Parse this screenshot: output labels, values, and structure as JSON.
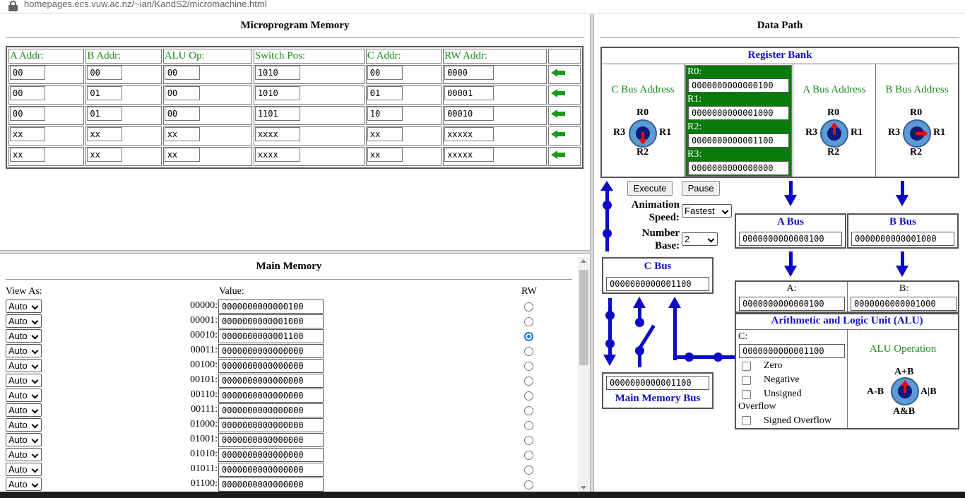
{
  "browser": {
    "url": "homepages.ecs.vuw.ac.nz/~ian/KandS2/micromachine.html"
  },
  "micro": {
    "title": "Microprogram Memory",
    "headers": [
      "A Addr:",
      "B Addr:",
      "ALU Op:",
      "Switch Pos:",
      "C Addr:",
      "RW Addr:"
    ],
    "rows": [
      [
        "00",
        "00",
        "00",
        "1010",
        "00",
        "0000"
      ],
      [
        "00",
        "01",
        "00",
        "1010",
        "01",
        "00001"
      ],
      [
        "00",
        "01",
        "00",
        "1101",
        "10",
        "00010"
      ],
      [
        "xx",
        "xx",
        "xx",
        "xxxx",
        "xx",
        "xxxxx"
      ],
      [
        "xx",
        "xx",
        "xx",
        "xxxx",
        "xx",
        "xxxxx"
      ]
    ]
  },
  "mainmem": {
    "title": "Main Memory",
    "view_as": "View As:",
    "value": "Value:",
    "rw": "RW",
    "rows": [
      {
        "view": "Auto",
        "addr": "00000:",
        "val": "0000000000000100",
        "rw": false
      },
      {
        "view": "Auto",
        "addr": "00001:",
        "val": "0000000000001000",
        "rw": false
      },
      {
        "view": "Auto",
        "addr": "00010:",
        "val": "0000000000001100",
        "rw": true
      },
      {
        "view": "Auto",
        "addr": "00011:",
        "val": "0000000000000000",
        "rw": false
      },
      {
        "view": "Auto",
        "addr": "00100:",
        "val": "0000000000000000",
        "rw": false
      },
      {
        "view": "Auto",
        "addr": "00101:",
        "val": "0000000000000000",
        "rw": false
      },
      {
        "view": "Auto",
        "addr": "00110:",
        "val": "0000000000000000",
        "rw": false
      },
      {
        "view": "Auto",
        "addr": "00111:",
        "val": "0000000000000000",
        "rw": false
      },
      {
        "view": "Auto",
        "addr": "01000:",
        "val": "0000000000000000",
        "rw": false
      },
      {
        "view": "Auto",
        "addr": "01001:",
        "val": "0000000000000000",
        "rw": false
      },
      {
        "view": "Auto",
        "addr": "01010:",
        "val": "0000000000000000",
        "rw": false
      },
      {
        "view": "Auto",
        "addr": "01011:",
        "val": "0000000000000000",
        "rw": false
      },
      {
        "view": "Auto",
        "addr": "01100:",
        "val": "0000000000000000",
        "rw": false
      }
    ]
  },
  "datapath": {
    "title": "Data Path",
    "reg_bank": "Register Bank",
    "c_bus_addr": "C Bus Address",
    "a_bus_addr": "A Bus Address",
    "b_bus_addr": "B Bus Address",
    "r0": "R0",
    "r1": "R1",
    "r2": "R2",
    "r3": "R3",
    "regs": [
      {
        "label": "R0:",
        "val": "0000000000000100"
      },
      {
        "label": "R1:",
        "val": "0000000000001000"
      },
      {
        "label": "R2:",
        "val": "0000000000001100"
      },
      {
        "label": "R3:",
        "val": "0000000000000000"
      }
    ],
    "execute": "Execute",
    "pause": "Pause",
    "anim_label": "Animation Speed:",
    "anim_val": "Fastest",
    "base_label": "Number Base:",
    "base_val": "2",
    "a_bus": "A Bus",
    "a_bus_val": "0000000000000100",
    "b_bus": "B Bus",
    "b_bus_val": "0000000000001000",
    "c_bus": "C Bus",
    "c_bus_val": "0000000000001100",
    "a_lbl": "A:",
    "a_val": "0000000000000100",
    "b_lbl": "B:",
    "b_val": "0000000000001000",
    "alu": "Arithmetic and Logic Unit (ALU)",
    "c_lbl": "C:",
    "c_val": "0000000000001100",
    "flags": [
      "Zero",
      "Negative",
      "Unsigned"
    ],
    "overflow": "Overflow",
    "signed_overflow": "Signed Overflow",
    "alu_op": "ALU Operation",
    "op_top": "A+B",
    "op_left": "A-B",
    "op_right": "A|B",
    "op_bottom": "A&B",
    "mm_bus_val": "0000000000001100",
    "mm_bus": "Main Memory Bus"
  },
  "colors": {
    "green": "#1a8a1a",
    "blue": "#1010c0",
    "reg_green": "#0a7a0a",
    "bus": "#0a0ac8",
    "arrow_red": "#e01010"
  }
}
